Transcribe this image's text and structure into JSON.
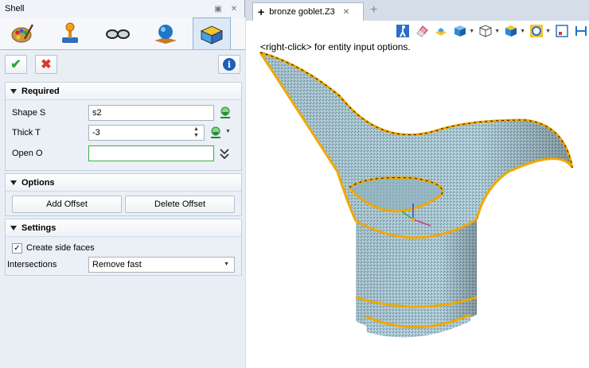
{
  "panel": {
    "title": "Shell",
    "pin_glyph": "▣",
    "close_glyph": "✕"
  },
  "ribbon": {
    "icons": [
      "paint-palette-icon",
      "joystick-icon",
      "glasses-icon",
      "sphere-on-plane-icon",
      "shell-command-icon"
    ],
    "active_index": 4
  },
  "actions": {
    "ok_glyph": "✔",
    "cancel_glyph": "✖",
    "info_glyph": "i"
  },
  "required": {
    "header": "Required",
    "shape_label": "Shape S",
    "shape_value": "s2",
    "thick_label": "Thick T",
    "thick_value": "-3",
    "open_label": "Open O",
    "open_value": ""
  },
  "options": {
    "header": "Options",
    "add_offset": "Add Offset",
    "delete_offset": "Delete Offset"
  },
  "settings": {
    "header": "Settings",
    "create_side_faces": "Create side faces",
    "create_side_faces_checked": true,
    "intersections_label": "Intersections",
    "intersections_value": "Remove fast"
  },
  "document": {
    "tab_plus": "+",
    "tab_title": "bronze goblet.Z3",
    "tab_close": "✕",
    "new_tab": "+",
    "hint": "<right-click> for entity input options."
  },
  "colors": {
    "accent_green": "#22aa33",
    "cancel_red": "#d83a2a",
    "info_blue": "#1d5fb8",
    "surface_blue": "#a9c7d3",
    "edge_orange": "#f0a800"
  }
}
